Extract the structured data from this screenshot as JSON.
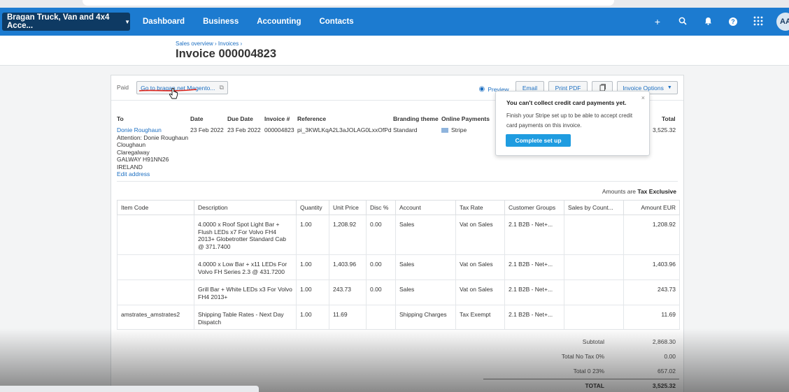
{
  "nav": {
    "org_name": "Bragan Truck, Van and 4x4 Acce...",
    "links": [
      "Dashboard",
      "Business",
      "Accounting",
      "Contacts"
    ],
    "avatar_initials": "AA"
  },
  "header": {
    "breadcrumb": "Sales overview › Invoices ›",
    "title": "Invoice 000004823"
  },
  "toolbar": {
    "status": "Paid",
    "magento_button": "Go to bragan.net Magento...",
    "preview": "Preview",
    "email": "Email",
    "print_pdf": "Print PDF",
    "invoice_options": "Invoice Options"
  },
  "details": {
    "headers": {
      "to": "To",
      "date": "Date",
      "due_date": "Due Date",
      "invoice_no": "Invoice #",
      "reference": "Reference",
      "branding": "Branding theme",
      "online_payments": "Online Payments",
      "total": "Total"
    },
    "contact_name": "Donie Roughaun",
    "address_lines": [
      "Attention: Donie Roughaun",
      "Cloughaun",
      "Claregalway",
      "GALWAY H91NN26",
      "IRELAND"
    ],
    "edit_address": "Edit address",
    "date": "23 Feb 2022",
    "due_date": "23 Feb 2022",
    "invoice_no": "000004823",
    "reference": "pi_3KWLKqA2L3aJOLAG0LxxOfPd",
    "branding": "Standard",
    "online_payments": "Stripe",
    "total": "3,525.32",
    "amounts_prefix": "Amounts are",
    "amounts_type": "Tax Exclusive"
  },
  "popup": {
    "title": "You can't collect credit card payments yet.",
    "body": "Finish your Stripe set up to be able to accept credit card payments on this invoice.",
    "button": "Complete set up",
    "close": "×"
  },
  "table": {
    "columns": [
      "Item Code",
      "Description",
      "Quantity",
      "Unit Price",
      "Disc %",
      "Account",
      "Tax Rate",
      "Customer Groups",
      "Sales by Count...",
      "Amount EUR"
    ],
    "rows": [
      {
        "code": "",
        "desc": "4.0000 x Roof Spot Light Bar + Flush LEDs x7 For Volvo FH4 2013+ Globetrotter Standard Cab @ 371.7400",
        "qty": "1.00",
        "price": "1,208.92",
        "disc": "0.00",
        "account": "Sales",
        "tax": "Vat on Sales",
        "group": "2.1 B2B - Net+...",
        "country": "",
        "amount": "1,208.92"
      },
      {
        "code": "",
        "desc": "4.0000 x Low Bar + x11 LEDs For Volvo FH Series 2.3 @ 431.7200",
        "qty": "1.00",
        "price": "1,403.96",
        "disc": "0.00",
        "account": "Sales",
        "tax": "Vat on Sales",
        "group": "2.1 B2B - Net+...",
        "country": "",
        "amount": "1,403.96"
      },
      {
        "code": "",
        "desc": "Grill Bar + White LEDs x3 For Volvo FH4 2013+",
        "qty": "1.00",
        "price": "243.73",
        "disc": "0.00",
        "account": "Sales",
        "tax": "Vat on Sales",
        "group": "2.1 B2B - Net+...",
        "country": "",
        "amount": "243.73"
      },
      {
        "code": "amstrates_amstrates2",
        "desc": "Shipping Table Rates - Next Day Dispatch",
        "qty": "1.00",
        "price": "11.69",
        "disc": "",
        "account": "Shipping Charges",
        "tax": "Tax Exempt",
        "group": "2.1 B2B - Net+...",
        "country": "",
        "amount": "11.69"
      }
    ]
  },
  "totals": [
    {
      "label": "Subtotal",
      "value": "2,868.30"
    },
    {
      "label": "Total No Tax 0%",
      "value": "0.00"
    },
    {
      "label": "Total 0 23%",
      "value": "657.02"
    },
    {
      "label": "TOTAL",
      "value": "3,525.32"
    }
  ]
}
